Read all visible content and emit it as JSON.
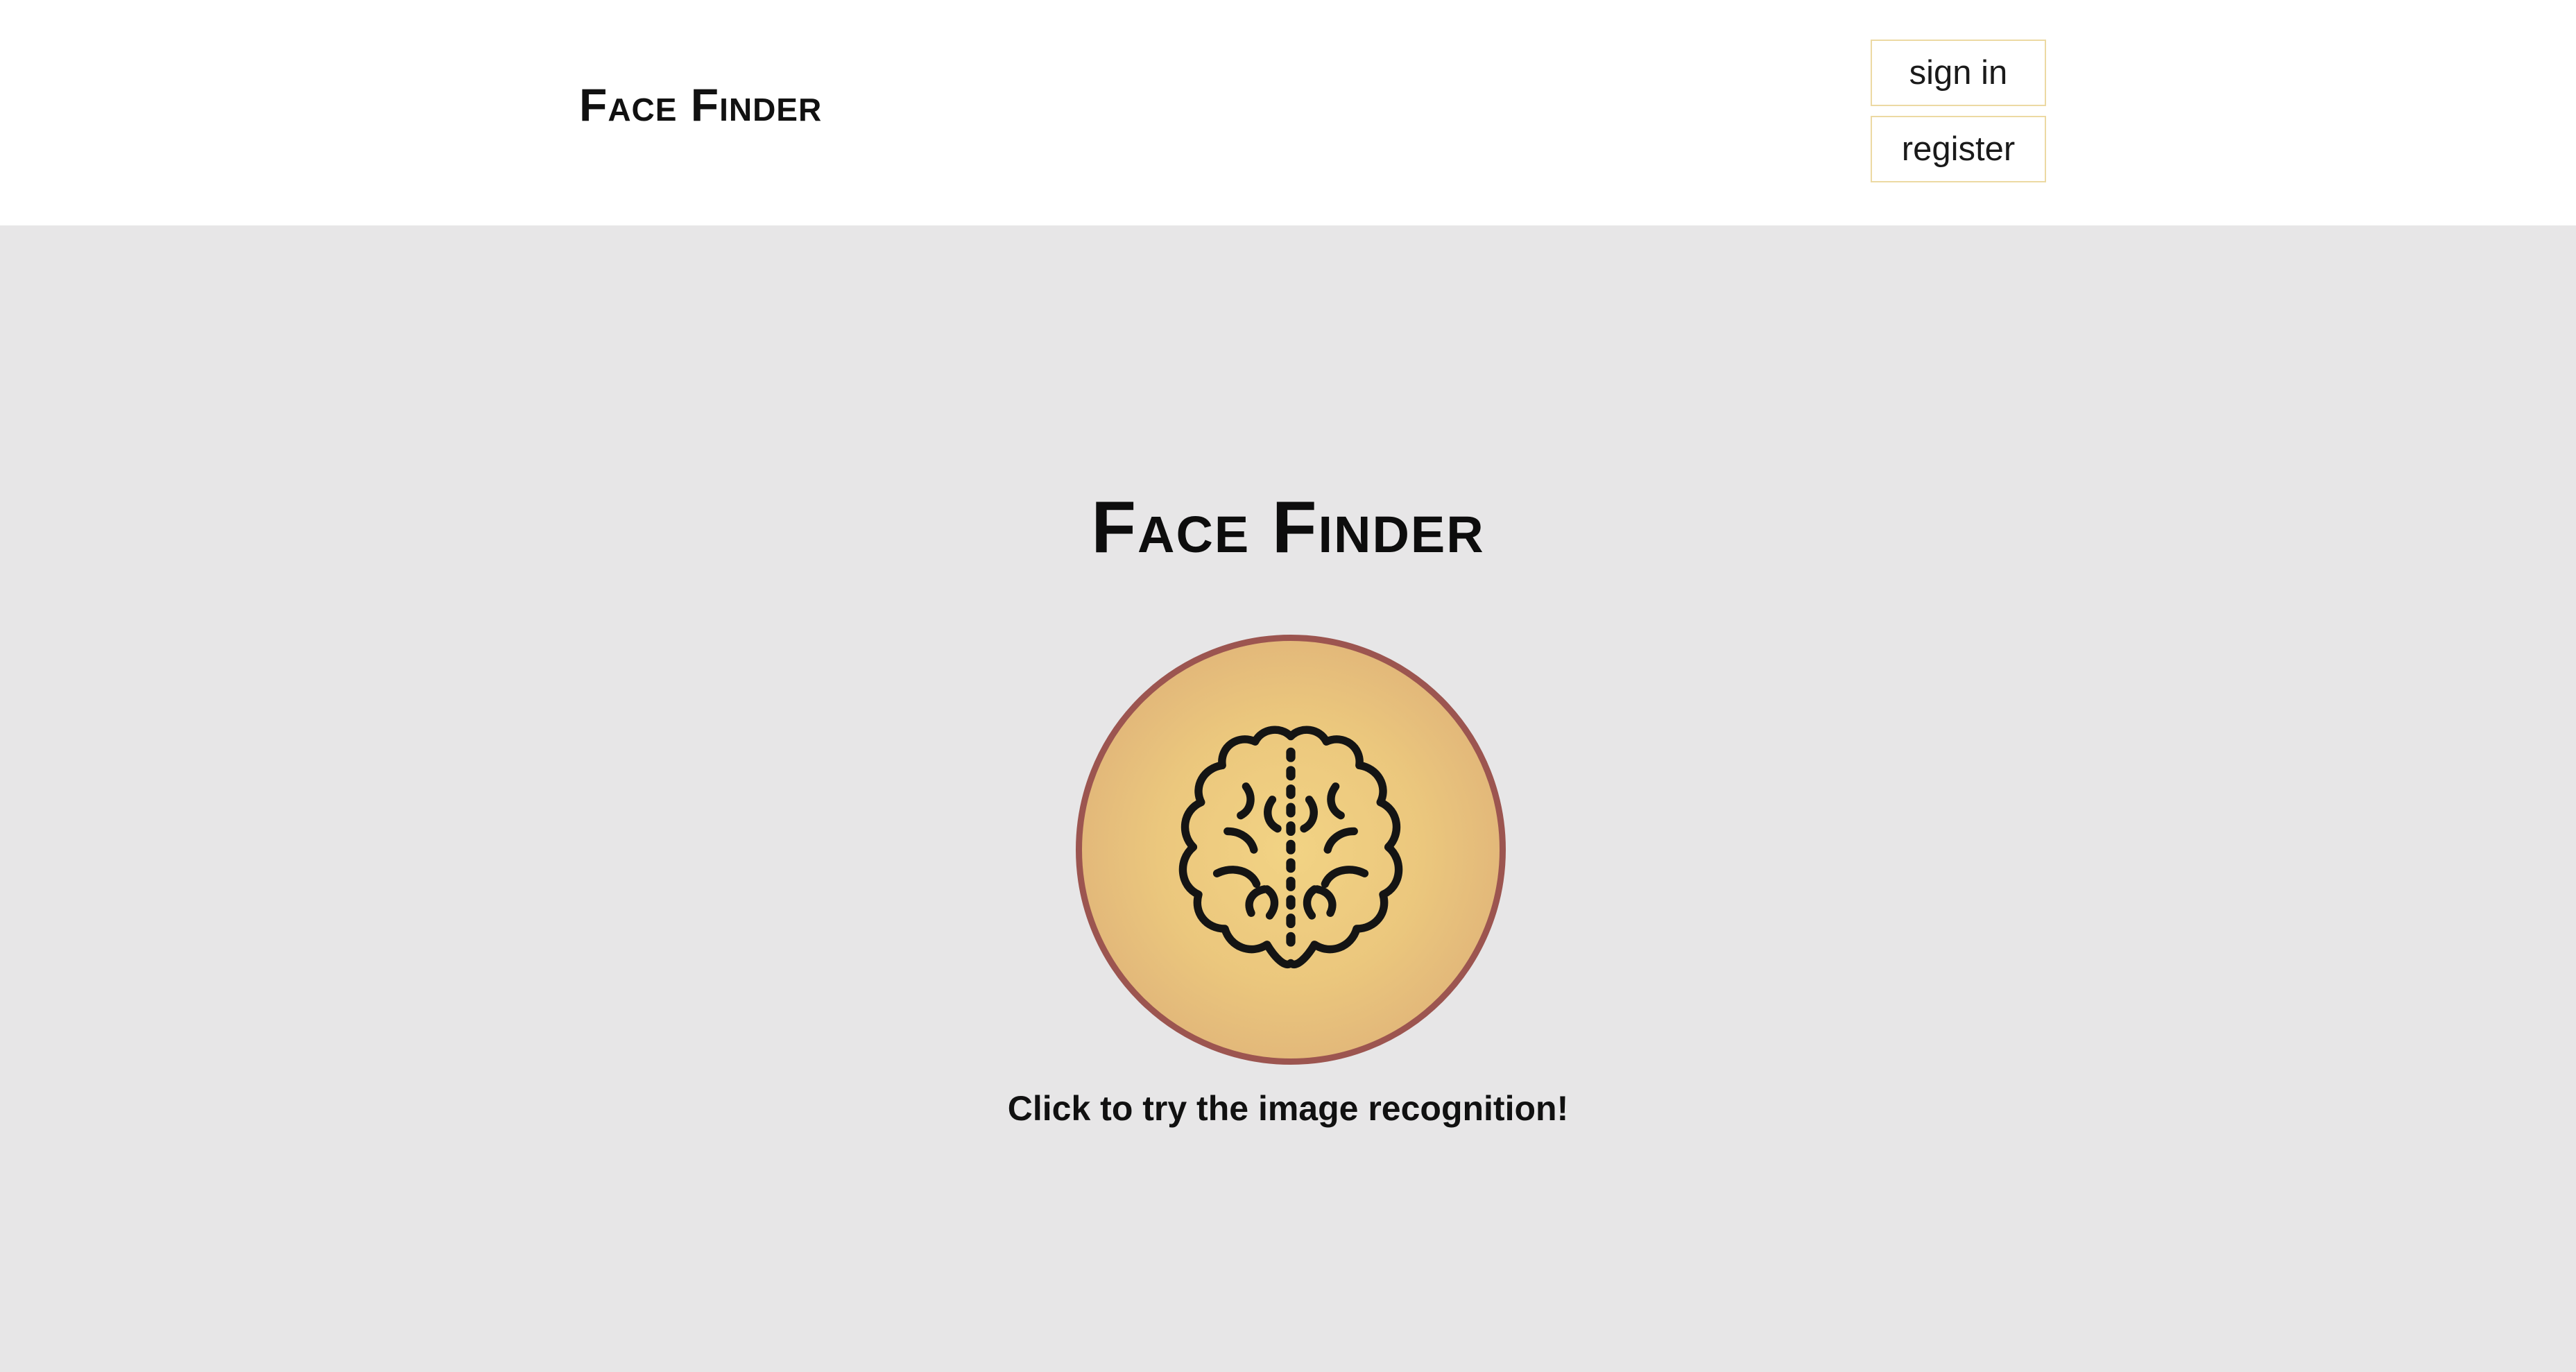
{
  "header": {
    "brand": "Face Finder",
    "sign_in_label": "sign in",
    "register_label": "register"
  },
  "main": {
    "title": "Face Finder",
    "button_icon": "brain-icon",
    "cta": "Click to try the image recognition!"
  },
  "colors": {
    "header_bg": "#ffffff",
    "page_bg": "#e7e6e7",
    "button_border": "#ecd9a3",
    "circle_border": "#9c5550",
    "circle_center": "#f2d384",
    "circle_edge": "#d9a877"
  }
}
